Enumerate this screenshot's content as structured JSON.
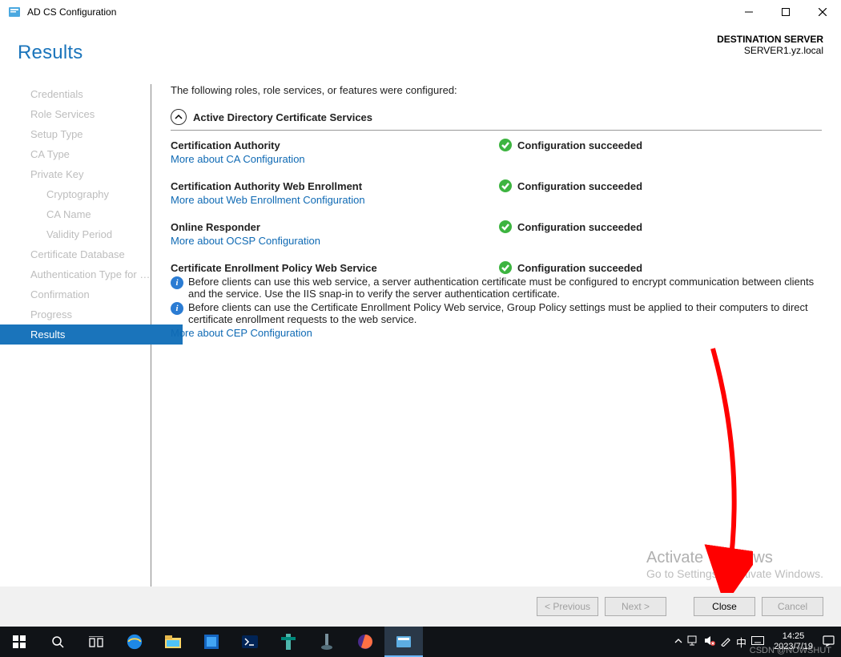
{
  "window": {
    "title": "AD CS Configuration",
    "page_title": "Results",
    "destination_label": "DESTINATION SERVER",
    "destination_server": "SERVER1.yz.local"
  },
  "sidebar": {
    "steps": [
      {
        "label": "Credentials",
        "selected": false,
        "sub": false
      },
      {
        "label": "Role Services",
        "selected": false,
        "sub": false
      },
      {
        "label": "Setup Type",
        "selected": false,
        "sub": false
      },
      {
        "label": "CA Type",
        "selected": false,
        "sub": false
      },
      {
        "label": "Private Key",
        "selected": false,
        "sub": false
      },
      {
        "label": "Cryptography",
        "selected": false,
        "sub": true
      },
      {
        "label": "CA Name",
        "selected": false,
        "sub": true
      },
      {
        "label": "Validity Period",
        "selected": false,
        "sub": true
      },
      {
        "label": "Certificate Database",
        "selected": false,
        "sub": false
      },
      {
        "label": "Authentication Type for C...",
        "selected": false,
        "sub": false
      },
      {
        "label": "Confirmation",
        "selected": false,
        "sub": false
      },
      {
        "label": "Progress",
        "selected": false,
        "sub": false
      },
      {
        "label": "Results",
        "selected": true,
        "sub": false
      }
    ]
  },
  "content": {
    "intro": "The following roles, role services, or features were configured:",
    "section_title": "Active Directory Certificate Services",
    "status_text": "Configuration succeeded",
    "roles": [
      {
        "name": "Certification Authority",
        "link": "More about CA Configuration",
        "notes": []
      },
      {
        "name": "Certification Authority Web Enrollment",
        "link": "More about Web Enrollment Configuration",
        "notes": []
      },
      {
        "name": "Online Responder",
        "link": "More about OCSP Configuration",
        "notes": []
      },
      {
        "name": "Certificate Enrollment Policy Web Service",
        "link": "More about CEP Configuration",
        "notes": [
          "Before clients can use this web service, a server authentication certificate must be configured to encrypt communication between clients and the service. Use the IIS snap-in to verify the server authentication certificate.",
          "Before clients can use the Certificate Enrollment Policy Web service, Group Policy settings must be applied to their computers to direct certificate enrollment requests to the web service."
        ]
      }
    ]
  },
  "activate": {
    "title": "Activate Windows",
    "sub": "Go to Settings to activate Windows."
  },
  "footer": {
    "previous": "< Previous",
    "next": "Next >",
    "close": "Close",
    "cancel": "Cancel"
  },
  "taskbar": {
    "time": "14:25",
    "date": "2023/7/19",
    "watermark": "CSDN @NOWSHUT"
  }
}
